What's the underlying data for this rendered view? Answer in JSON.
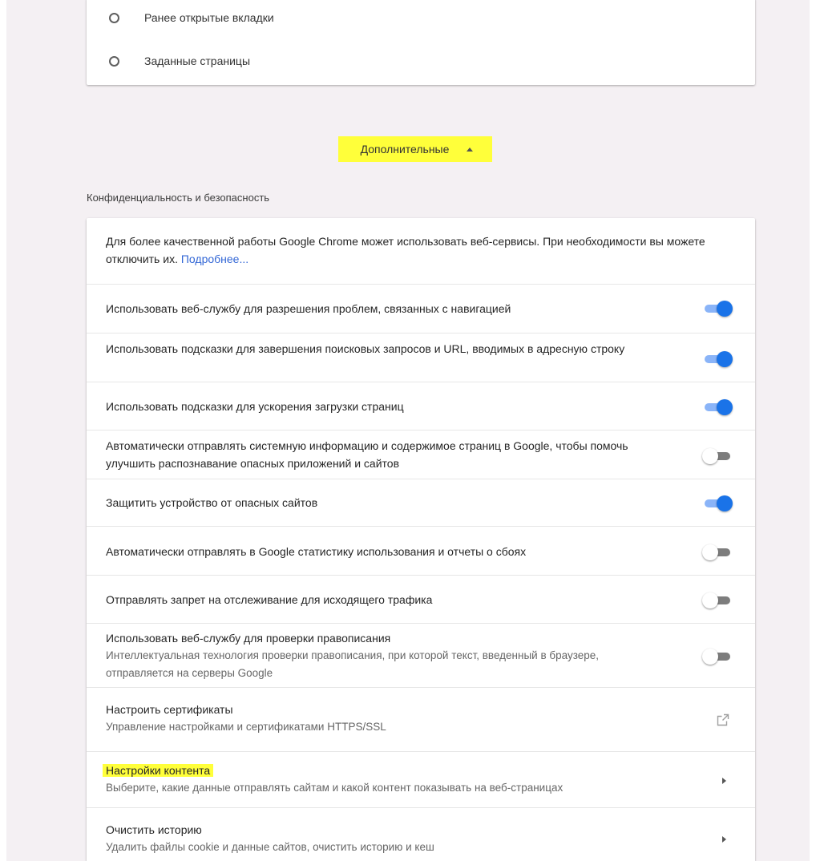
{
  "startup": {
    "options": [
      {
        "label": "Ранее открытые вкладки"
      },
      {
        "label": "Заданные страницы"
      }
    ]
  },
  "advanced": {
    "label": "Дополнительные",
    "icon": "arrow-up-icon",
    "highlight_color": "#ffff3a"
  },
  "privacy": {
    "section_title": "Конфиденциальность и безопасность",
    "intro": {
      "text": "Для более качественной работы Google Chrome может использовать веб-сервисы. При необходимости вы можете отключить их.",
      "link": "Подробнее..."
    },
    "toggles": [
      {
        "label": "Использовать веб-службу для разрешения проблем, связанных с навигацией",
        "state": "on"
      },
      {
        "label": "Использовать подсказки для завершения поисковых запросов и URL, вводимых в адресную строку",
        "state": "on"
      },
      {
        "label": "Использовать подсказки для ускорения загрузки страниц",
        "state": "on"
      },
      {
        "label": "Автоматически отправлять системную информацию и содержимое страниц в Google, чтобы помочь улучшить распознавание опасных приложений и сайтов",
        "state": "off"
      },
      {
        "label": "Защитить устройство от опасных сайтов",
        "state": "on"
      },
      {
        "label": "Автоматически отправлять в Google статистику использования и отчеты о сбоях",
        "state": "off"
      },
      {
        "label": "Отправлять запрет на отслеживание для исходящего трафика",
        "state": "off"
      },
      {
        "label": "Использовать веб-службу для проверки правописания",
        "sublabel": "Интеллектуальная технология проверки правописания, при которой текст, введенный в браузере, отправляется на серверы Google",
        "state": "off"
      }
    ],
    "certificates": {
      "title": "Настроить сертификаты",
      "subtitle": "Управление настройками и сертификатами HTTPS/SSL",
      "icon": "external-link-icon"
    },
    "content_settings": {
      "title": "Настройки контента",
      "subtitle": "Выберите, какие данные отправлять сайтам и какой контент показывать на веб-страницах",
      "icon": "chevron-right-icon"
    },
    "clear_history": {
      "title": "Очистить историю",
      "subtitle": "Удалить файлы cookie и данные сайтов, очистить историю и кеш",
      "icon": "chevron-right-icon"
    }
  },
  "colors": {
    "toggle_on": "#1a73e8",
    "toggle_on_track": "#8ab4f8",
    "toggle_off_track": "#7d7d7d",
    "link": "#3367d6",
    "page_bg": "#f4f0f3"
  }
}
